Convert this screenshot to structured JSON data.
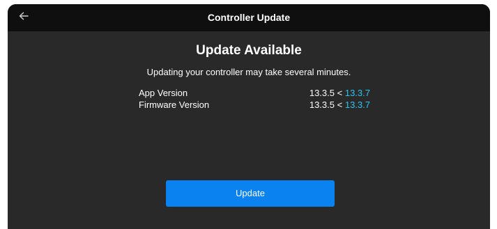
{
  "header": {
    "title": "Controller Update",
    "back_icon": "arrow-left-icon"
  },
  "main": {
    "heading": "Update Available",
    "message": "Updating your controller may take several minutes.",
    "versions": [
      {
        "label": "App Version",
        "current": "13.3.5",
        "separator": "<",
        "latest": "13.3.7"
      },
      {
        "label": "Firmware Version",
        "current": "13.3.5",
        "separator": "<",
        "latest": "13.3.7"
      }
    ],
    "update_label": "Update"
  },
  "colors": {
    "background": "#292929",
    "titlebar": "#0f0f0f",
    "accent": "#0a82f0",
    "latest_version": "#2cc5f0"
  }
}
